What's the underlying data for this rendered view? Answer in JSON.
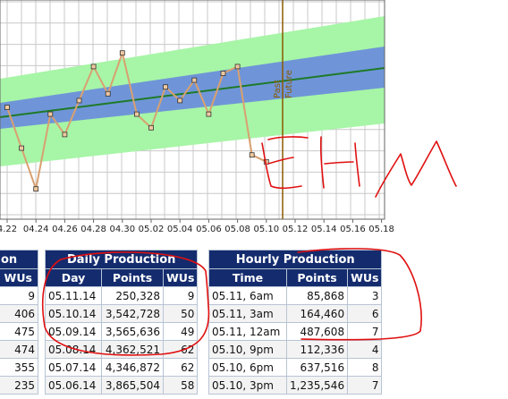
{
  "chart_data": {
    "type": "line",
    "x_tick_labels": [
      "4.22",
      "04.24",
      "04.26",
      "04.28",
      "04.30",
      "05.02",
      "05.04",
      "05.06",
      "05.08",
      "05.10",
      "05.12",
      "05.14",
      "05.16",
      "05.18"
    ],
    "marker_label_past": "Past",
    "marker_label_future": "Future",
    "series": [
      {
        "values": [
          5,
          2,
          -1,
          4.5,
          3,
          5.5,
          8,
          6,
          9,
          4.5,
          3.5,
          6.5,
          5.5,
          7,
          4.5,
          7.5,
          8,
          1.5,
          1
        ]
      }
    ],
    "colors": {
      "series": "#d9a070",
      "trend": "#1e7a28",
      "band_inner": "#6c93d6",
      "band_outer": "#a7f5a7",
      "marker": "#8b5a00"
    }
  },
  "left_table": {
    "title": "on",
    "col_wus": "WUs",
    "rows": [
      "9",
      "406",
      "475",
      "474",
      "355",
      "235"
    ]
  },
  "daily": {
    "title": "Daily Production",
    "col_day": "Day",
    "col_points": "Points",
    "col_wus": "WUs",
    "rows": [
      {
        "day": "05.11.14",
        "points": "250,328",
        "wus": "9"
      },
      {
        "day": "05.10.14",
        "points": "3,542,728",
        "wus": "50"
      },
      {
        "day": "05.09.14",
        "points": "3,565,636",
        "wus": "49"
      },
      {
        "day": "05.08.14",
        "points": "4,362,521",
        "wus": "62"
      },
      {
        "day": "05.07.14",
        "points": "4,346,872",
        "wus": "62"
      },
      {
        "day": "05.06.14",
        "points": "3,865,504",
        "wus": "58"
      }
    ]
  },
  "hourly": {
    "title": "Hourly Production",
    "col_time": "Time",
    "col_points": "Points",
    "col_wus": "WUs",
    "rows": [
      {
        "time": "05.11, 6am",
        "points": "85,868",
        "wus": "3"
      },
      {
        "time": "05.11, 3am",
        "points": "164,460",
        "wus": "6"
      },
      {
        "time": "05.11, 12am",
        "points": "487,608",
        "wus": "7"
      },
      {
        "time": "05.10, 9pm",
        "points": "112,336",
        "wus": "4"
      },
      {
        "time": "05.10, 6pm",
        "points": "637,516",
        "wus": "8"
      },
      {
        "time": "05.10, 3pm",
        "points": "1,235,546",
        "wus": "7"
      }
    ]
  }
}
